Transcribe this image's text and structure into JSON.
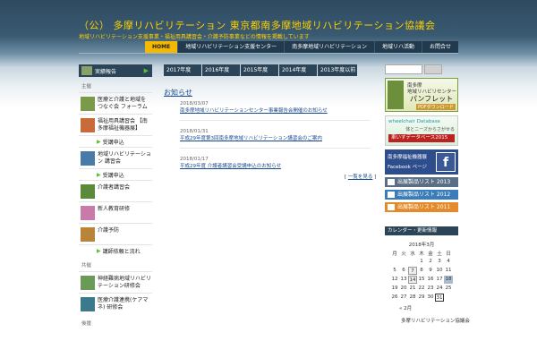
{
  "header": {
    "title": "（公） 多摩リハビリテーション 東京都南多摩地域リハビリテーション協議会",
    "description": "地域リハビリテーション支援事業・福祉用具講習会・介護予防事業などの情報を掲載しています"
  },
  "nav": [
    "HOME",
    "地域リハビリテーション支援センター",
    "南多摩地域リハビリテーション",
    "地域リハ活動",
    "お問合せ"
  ],
  "left_sidebar": {
    "jisseki": "実績報告",
    "section1": "主催",
    "items": [
      {
        "label": "医療と介護と地域を つなぐ会 フォーラム",
        "color": "#7a9a4a"
      },
      {
        "label": "福祉用具講習会 【南多摩福祉機器展】",
        "color": "#c96a3a",
        "sub": "受講申込"
      },
      {
        "label": "地域リハビリテーション 講習会",
        "color": "#4a7aa8",
        "sub": "受講申込"
      },
      {
        "label": "介護者講習会",
        "color": "#5a8a3a"
      },
      {
        "label": "新人教育研修",
        "color": "#c87aa8"
      },
      {
        "label": "介護予防",
        "color": "#b8843a",
        "sub": "講師依頼と流れ"
      }
    ],
    "section2": "共催",
    "items2": [
      {
        "label": "神経難病地域リハビリ テーション研修会",
        "color": "#6a9a5a"
      },
      {
        "label": "医療介護連携(ケアマネ) 研修会",
        "color": "#3a7a8a"
      }
    ],
    "section3": "後援"
  },
  "tabs": [
    "2017年度",
    "2016年度",
    "2015年度",
    "2014年度",
    "2013年度以前"
  ],
  "main": {
    "title": "お知らせ",
    "posts": [
      {
        "date": "2018/03/07",
        "title": "南多摩地域リハビリテーションセンター事業報告会開催のお知らせ"
      },
      {
        "date": "2018/01/31",
        "title": "平成29年度第3回南多摩地域リハビリテーション講習会のご案内"
      },
      {
        "date": "2018/01/17",
        "title": "平成29年度 介護者講習会受講申込のお知らせ"
      }
    ],
    "more": "一覧を見る"
  },
  "right_sidebar": {
    "banner1": {
      "l1": "南多摩",
      "l2": "地域リハビリセンター",
      "title": "パンフレット",
      "sub": "PDFダウンロード"
    },
    "banner2": {
      "l1": "wheelchair Database",
      "l2": "体とニーズからさがせる",
      "l3": "車いすデータベース2015"
    },
    "fb": {
      "l1": "南多摩福祉機器展",
      "l2": "Facebook ページ",
      "logo": "f"
    },
    "lists": [
      "出展製品リスト 2013",
      "出展製品リスト 2012",
      "出展製品リスト 2011"
    ],
    "calendar_head": "カレンダー・更新情報",
    "calendar": {
      "month": "2018年3月",
      "weekdays": [
        "月",
        "火",
        "水",
        "木",
        "金",
        "土",
        "日"
      ],
      "rows": [
        [
          "",
          "",
          "",
          "1",
          "2",
          "3",
          "4"
        ],
        [
          "5",
          "6",
          "7",
          "8",
          "9",
          "10",
          "11"
        ],
        [
          "12",
          "13",
          "14",
          "15",
          "16",
          "17",
          "18"
        ],
        [
          "19",
          "20",
          "21",
          "22",
          "23",
          "24",
          "25"
        ],
        [
          "26",
          "27",
          "28",
          "29",
          "30",
          "31",
          ""
        ]
      ],
      "prev": "« 2月",
      "link": "多摩リハビリテーション協議会"
    }
  }
}
